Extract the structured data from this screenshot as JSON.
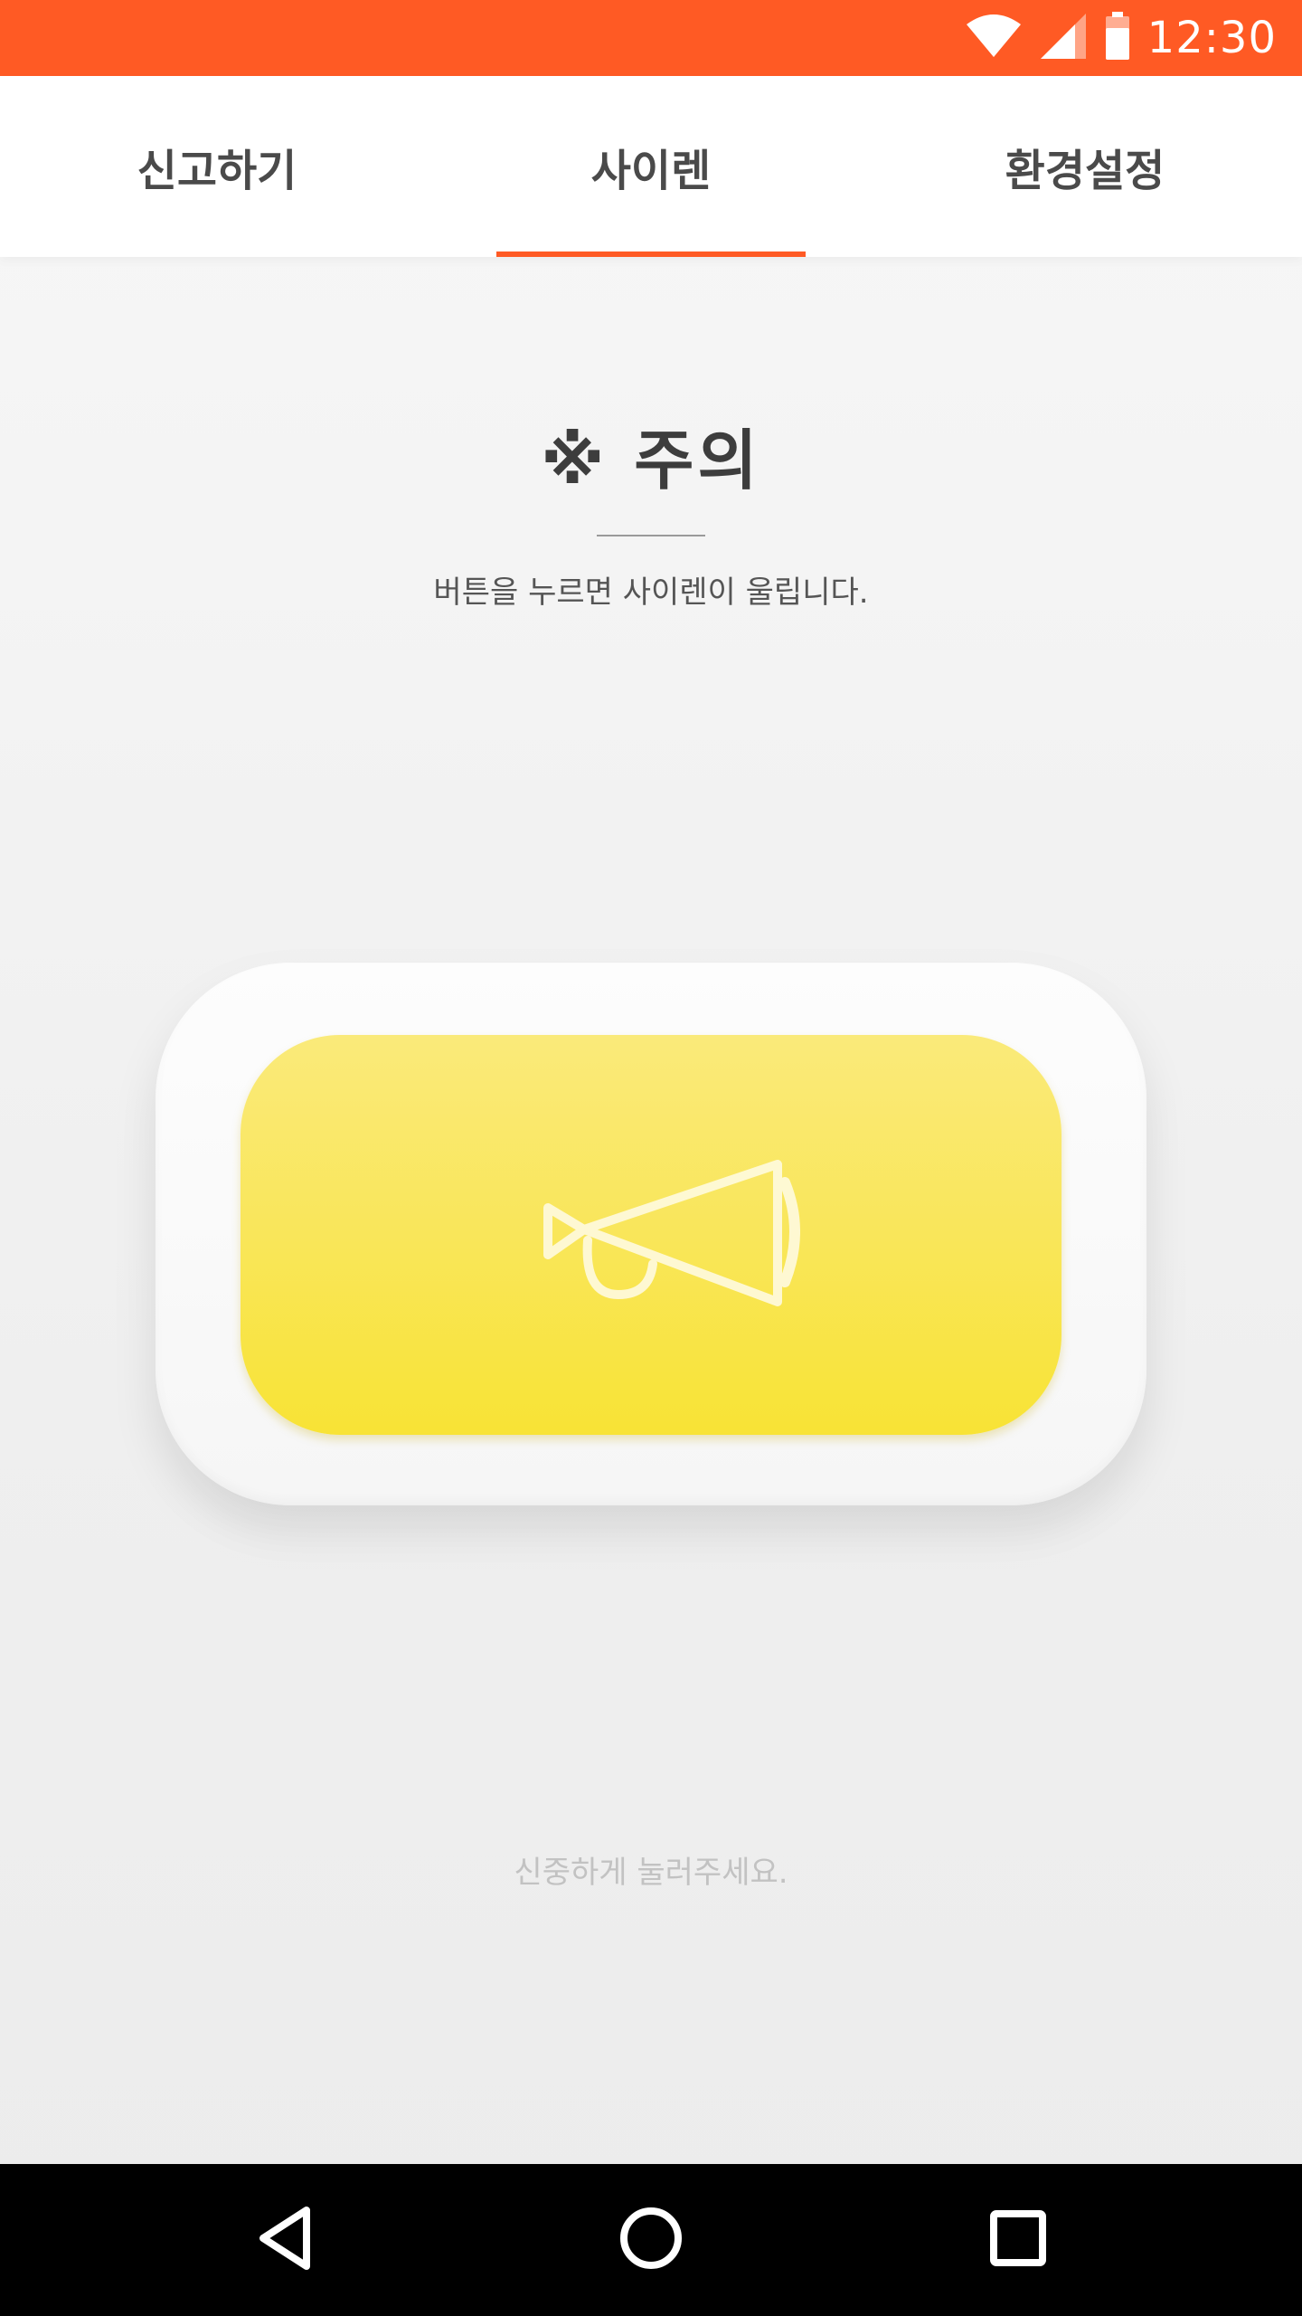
{
  "status_bar": {
    "time": "12:30",
    "icons": [
      "wifi-icon",
      "signal-icon",
      "battery-icon"
    ],
    "color": "#ff5a24"
  },
  "tabs": [
    {
      "label": "신고하기",
      "active": false
    },
    {
      "label": "사이렌",
      "active": true
    },
    {
      "label": "환경설정",
      "active": false
    }
  ],
  "notice": {
    "title": "※ 주의",
    "description": "버튼을 누르면 사이렌이 울립니다."
  },
  "siren_button": {
    "icon": "megaphone-icon",
    "color": "#f9e65a"
  },
  "caution": "신중하게 눌러주세요.",
  "nav_bar": {
    "buttons": [
      "back-icon",
      "home-icon",
      "recents-icon"
    ]
  },
  "colors": {
    "accent": "#ff5a24",
    "button_yellow": "#f9e65a"
  }
}
